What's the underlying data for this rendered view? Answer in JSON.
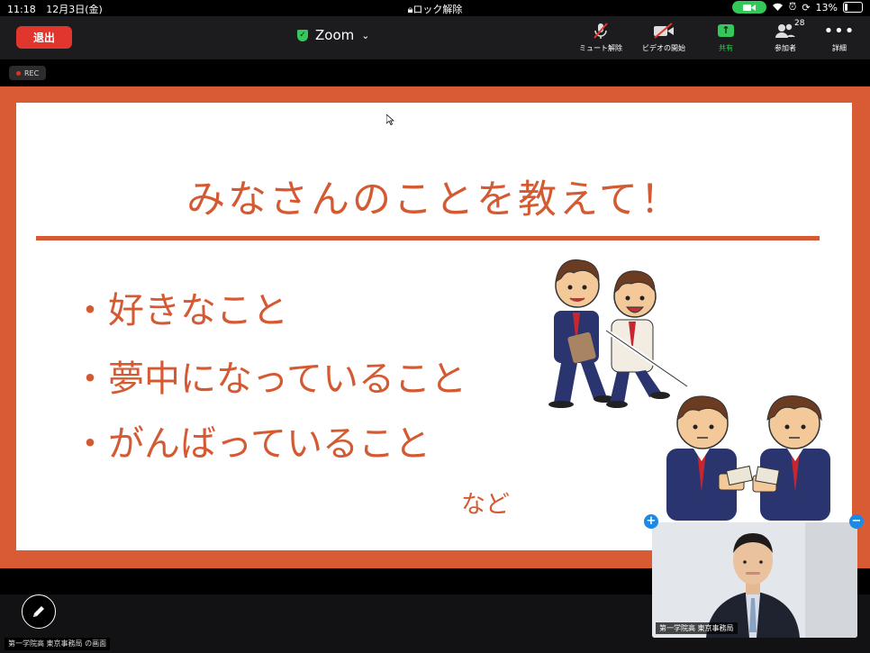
{
  "status_bar": {
    "time": "11:18",
    "date": "12月3日(金)",
    "lock_label": "ロック解除",
    "battery": "13%"
  },
  "toolbar": {
    "leave_label": "退出",
    "app_title": "Zoom",
    "mute_label": "ミュート解除",
    "video_label": "ビデオの開始",
    "share_label": "共有",
    "participants_label": "参加者",
    "participants_count": "28",
    "more_label": "詳細"
  },
  "recording": {
    "label": "REC"
  },
  "slide": {
    "title": "みなさんのことを教えて！",
    "bullets": [
      "・好きなこと",
      "・夢中になっていること",
      "・がんばっていること"
    ],
    "footer": "など"
  },
  "bottom": {
    "screen_owner_label": "第一学院高 東京事務局 の画面"
  },
  "video_tile": {
    "name": "第一学院高 東京事務局"
  },
  "colors": {
    "accent": "#d45a33",
    "leave": "#e0362d",
    "share_green": "#34c759",
    "zoom_blue": "#1e88e5"
  }
}
